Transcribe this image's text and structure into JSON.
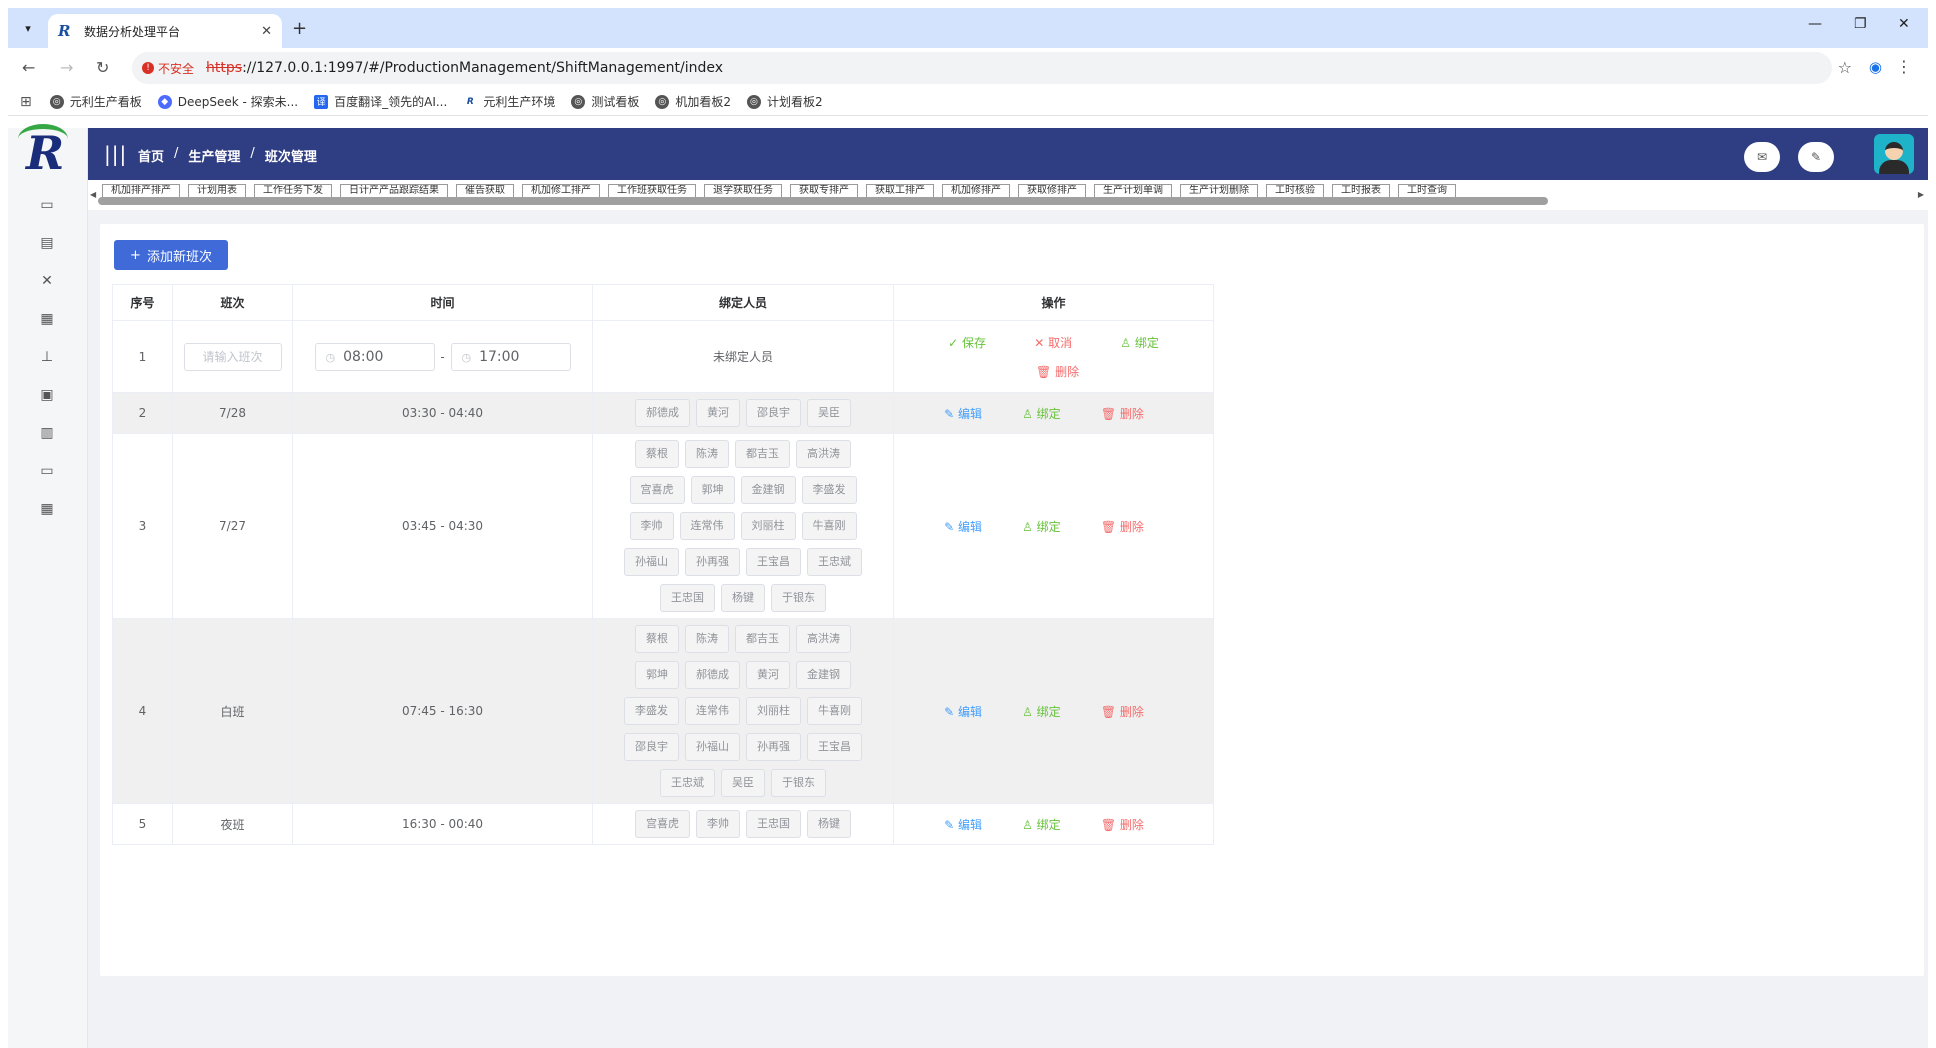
{
  "browser": {
    "tab_title": "数据分析处理平台",
    "tab_favicon": "R",
    "new_tab": "+",
    "insecure_label": "不安全",
    "url_scheme": "https",
    "url_rest": "://127.0.0.1:1997/#/ProductionManagement/ShiftManagement/index",
    "bookmarks": [
      {
        "label": "元利生产看板"
      },
      {
        "label": "DeepSeek - 探索未..."
      },
      {
        "label": "百度翻译_领先的AI..."
      },
      {
        "label": "元利生产环境"
      },
      {
        "label": "测试看板"
      },
      {
        "label": "机加看板2"
      },
      {
        "label": "计划看板2"
      }
    ]
  },
  "header": {
    "breadcrumbs": [
      "首页",
      "生产管理",
      "班次管理"
    ],
    "sep": "/"
  },
  "tags": [
    "机加排产排产",
    "计划用表",
    "工作任务下发",
    "日计产产品跟踪结果",
    "催告获取",
    "机加修工排产",
    "工作班获取任务",
    "退学获取任务",
    "获取专排产",
    "获取工排产",
    "机加修排产",
    "获取修排产",
    "生产计划单调",
    "生产计划删除",
    "工时核验",
    "工时报表",
    "工时查询"
  ],
  "toolbar": {
    "add_button": "添加新班次"
  },
  "table": {
    "headers": [
      "序号",
      "班次",
      "时间",
      "绑定人员",
      "操作"
    ],
    "edit_row": {
      "index": "1",
      "shift_placeholder": "请输入班次",
      "start_time": "08:00",
      "time_sep": "-",
      "end_time": "17:00",
      "persons_empty": "未绑定人员",
      "ops": [
        "保存",
        "取消",
        "绑定",
        "删除"
      ]
    },
    "rows": [
      {
        "index": "2",
        "shift": "7/28",
        "time": "03:30 - 04:40",
        "persons": [
          "郝德成",
          "黄河",
          "邵良宇",
          "吴臣"
        ]
      },
      {
        "index": "3",
        "shift": "7/27",
        "time": "03:45 - 04:30",
        "persons": [
          "蔡根",
          "陈涛",
          "都吉玉",
          "高洪涛",
          "宫喜虎",
          "郭坤",
          "金建钢",
          "李盛发",
          "李帅",
          "连常伟",
          "刘丽柱",
          "牛喜刚",
          "孙福山",
          "孙再强",
          "王宝昌",
          "王忠斌",
          "王忠国",
          "杨键",
          "于银东"
        ]
      },
      {
        "index": "4",
        "shift": "白班",
        "time": "07:45 - 16:30",
        "persons": [
          "蔡根",
          "陈涛",
          "都吉玉",
          "高洪涛",
          "郭坤",
          "郝德成",
          "黄河",
          "金建钢",
          "李盛发",
          "连常伟",
          "刘丽柱",
          "牛喜刚",
          "邵良宇",
          "孙福山",
          "孙再强",
          "王宝昌",
          "王忠斌",
          "吴臣",
          "于银东"
        ]
      },
      {
        "index": "5",
        "shift": "夜班",
        "time": "16:30 - 00:40",
        "persons": [
          "宫喜虎",
          "李帅",
          "王忠国",
          "杨键"
        ]
      }
    ],
    "row_ops": [
      "编辑",
      "绑定",
      "删除"
    ]
  }
}
